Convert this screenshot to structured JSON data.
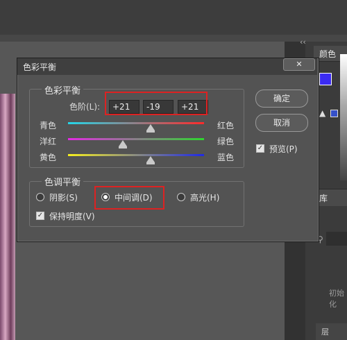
{
  "panel": {
    "color_tab": "颜色",
    "library_tab": "库",
    "init_label": "初始化",
    "scroll_label": "层",
    "collapse_glyph": "‹‹",
    "fg_color": "#3b2bf2",
    "bg_color": "#ffffff",
    "gamut_color": "#3550c9"
  },
  "dialog": {
    "title": "色彩平衡",
    "close_glyph": "✕",
    "color_balance_legend": "色彩平衡",
    "levels_label": "色阶(L):",
    "levels": [
      "+21",
      "-19",
      "+21"
    ],
    "sliders": [
      {
        "left": "青色",
        "right": "红色",
        "value": 21
      },
      {
        "left": "洋红",
        "right": "绿色",
        "value": -19
      },
      {
        "left": "黄色",
        "right": "蓝色",
        "value": 21
      }
    ],
    "tone_legend": "色调平衡",
    "tones": [
      {
        "label": "阴影(S)",
        "selected": false
      },
      {
        "label": "中间调(D)",
        "selected": true
      },
      {
        "label": "高光(H)",
        "selected": false
      }
    ],
    "preserve_luminosity": "保持明度(V)",
    "preserve_checked": true,
    "ok_label": "确定",
    "cancel_label": "取消",
    "preview_label": "预览(P)",
    "preview_checked": true
  },
  "highlight_color": "#dd2222"
}
